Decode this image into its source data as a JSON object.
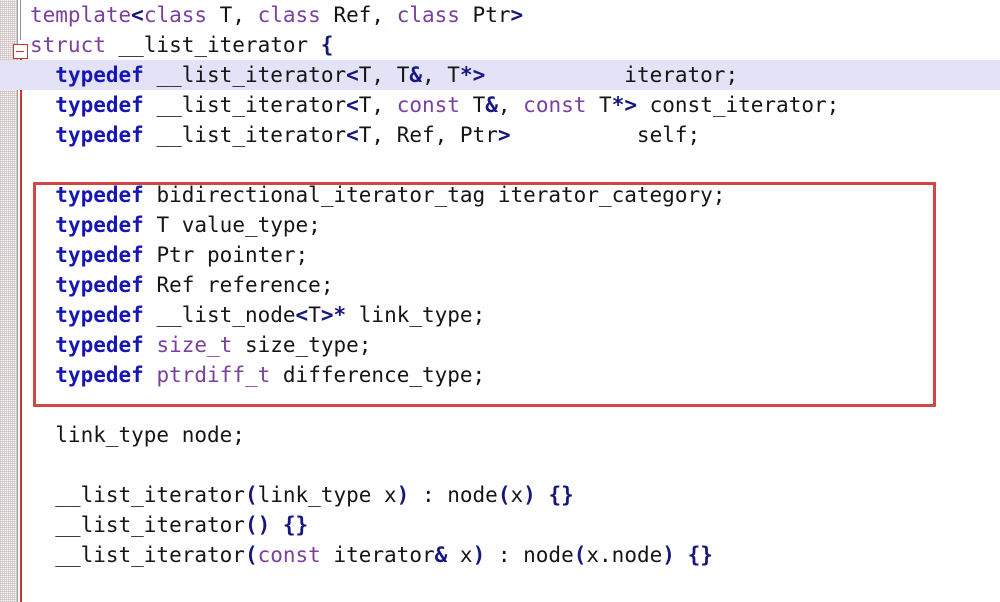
{
  "editor": {
    "title": "code-editor-view",
    "language": "C++",
    "font_size_px": 21,
    "line_height_px": 30,
    "background": "#ffffff",
    "highlight_color": "#e3e2f7",
    "keyword_color": "#7b3fa0",
    "typedef_color": "#1616b4",
    "punctuation_color": "#161680",
    "text_color": "#151515",
    "annotation_color": "#cf4642",
    "fold_marker": {
      "name": "fold-collapse-marker",
      "glyph": "-",
      "line": 2
    }
  },
  "annotation": {
    "name": "red-highlight-box",
    "color": "#cf4642",
    "covers_lines": [
      7,
      8,
      9,
      10,
      11,
      12,
      13
    ]
  },
  "lines": [
    {
      "n": 1,
      "highlighted": false,
      "tokens": [
        {
          "t": "template",
          "c": "kw"
        },
        {
          "t": "<",
          "c": "punct"
        },
        {
          "t": "class",
          "c": "kw"
        },
        {
          "t": " T, ",
          "c": "plain"
        },
        {
          "t": "class",
          "c": "kw"
        },
        {
          "t": " Ref, ",
          "c": "plain"
        },
        {
          "t": "class",
          "c": "kw"
        },
        {
          "t": " Ptr",
          "c": "plain"
        },
        {
          "t": ">",
          "c": "punct"
        }
      ]
    },
    {
      "n": 2,
      "highlighted": false,
      "tokens": [
        {
          "t": "struct",
          "c": "kw"
        },
        {
          "t": " __list_iterator ",
          "c": "plain"
        },
        {
          "t": "{",
          "c": "punct"
        }
      ]
    },
    {
      "n": 3,
      "highlighted": true,
      "tokens": [
        {
          "t": "  ",
          "c": "plain"
        },
        {
          "t": "typedef",
          "c": "tdef"
        },
        {
          "t": " __list_iterator",
          "c": "plain"
        },
        {
          "t": "<",
          "c": "punct"
        },
        {
          "t": "T, T",
          "c": "plain"
        },
        {
          "t": "&",
          "c": "punct"
        },
        {
          "t": ", T",
          "c": "plain"
        },
        {
          "t": "*>",
          "c": "punct"
        },
        {
          "t": "           iterator;",
          "c": "plain"
        }
      ]
    },
    {
      "n": 4,
      "highlighted": false,
      "tokens": [
        {
          "t": "  ",
          "c": "plain"
        },
        {
          "t": "typedef",
          "c": "tdef"
        },
        {
          "t": " __list_iterator",
          "c": "plain"
        },
        {
          "t": "<",
          "c": "punct"
        },
        {
          "t": "T, ",
          "c": "plain"
        },
        {
          "t": "const",
          "c": "kw"
        },
        {
          "t": " T",
          "c": "plain"
        },
        {
          "t": "&",
          "c": "punct"
        },
        {
          "t": ", ",
          "c": "plain"
        },
        {
          "t": "const",
          "c": "kw"
        },
        {
          "t": " T",
          "c": "plain"
        },
        {
          "t": "*>",
          "c": "punct"
        },
        {
          "t": " const_iterator;",
          "c": "plain"
        }
      ]
    },
    {
      "n": 5,
      "highlighted": false,
      "tokens": [
        {
          "t": "  ",
          "c": "plain"
        },
        {
          "t": "typedef",
          "c": "tdef"
        },
        {
          "t": " __list_iterator",
          "c": "plain"
        },
        {
          "t": "<",
          "c": "punct"
        },
        {
          "t": "T, Ref, Ptr",
          "c": "plain"
        },
        {
          "t": ">",
          "c": "punct"
        },
        {
          "t": "          self;",
          "c": "plain"
        }
      ]
    },
    {
      "n": 6,
      "highlighted": false,
      "tokens": [
        {
          "t": "",
          "c": "plain"
        }
      ]
    },
    {
      "n": 7,
      "highlighted": false,
      "tokens": [
        {
          "t": "  ",
          "c": "plain"
        },
        {
          "t": "typedef",
          "c": "tdef"
        },
        {
          "t": " bidirectional_iterator_tag iterator_category;",
          "c": "plain"
        }
      ]
    },
    {
      "n": 8,
      "highlighted": false,
      "tokens": [
        {
          "t": "  ",
          "c": "plain"
        },
        {
          "t": "typedef",
          "c": "tdef"
        },
        {
          "t": " T value_type;",
          "c": "plain"
        }
      ]
    },
    {
      "n": 9,
      "highlighted": false,
      "tokens": [
        {
          "t": "  ",
          "c": "plain"
        },
        {
          "t": "typedef",
          "c": "tdef"
        },
        {
          "t": " Ptr pointer;",
          "c": "plain"
        }
      ]
    },
    {
      "n": 10,
      "highlighted": false,
      "tokens": [
        {
          "t": "  ",
          "c": "plain"
        },
        {
          "t": "typedef",
          "c": "tdef"
        },
        {
          "t": " Ref reference;",
          "c": "plain"
        }
      ]
    },
    {
      "n": 11,
      "highlighted": false,
      "tokens": [
        {
          "t": "  ",
          "c": "plain"
        },
        {
          "t": "typedef",
          "c": "tdef"
        },
        {
          "t": " __list_node",
          "c": "plain"
        },
        {
          "t": "<",
          "c": "punct"
        },
        {
          "t": "T",
          "c": "plain"
        },
        {
          "t": ">*",
          "c": "punct"
        },
        {
          "t": " link_type;",
          "c": "plain"
        }
      ]
    },
    {
      "n": 12,
      "highlighted": false,
      "tokens": [
        {
          "t": "  ",
          "c": "plain"
        },
        {
          "t": "typedef",
          "c": "tdef"
        },
        {
          "t": " ",
          "c": "plain"
        },
        {
          "t": "size_t",
          "c": "kw"
        },
        {
          "t": " size_type;",
          "c": "plain"
        }
      ]
    },
    {
      "n": 13,
      "highlighted": false,
      "tokens": [
        {
          "t": "  ",
          "c": "plain"
        },
        {
          "t": "typedef",
          "c": "tdef"
        },
        {
          "t": " ",
          "c": "plain"
        },
        {
          "t": "ptrdiff_t",
          "c": "kw"
        },
        {
          "t": " difference_type;",
          "c": "plain"
        }
      ]
    },
    {
      "n": 14,
      "highlighted": false,
      "tokens": [
        {
          "t": "",
          "c": "plain"
        }
      ]
    },
    {
      "n": 15,
      "highlighted": false,
      "tokens": [
        {
          "t": "  link_type node;",
          "c": "plain"
        }
      ]
    },
    {
      "n": 16,
      "highlighted": false,
      "tokens": [
        {
          "t": "",
          "c": "plain"
        }
      ]
    },
    {
      "n": 17,
      "highlighted": false,
      "tokens": [
        {
          "t": "  __list_iterator",
          "c": "plain"
        },
        {
          "t": "(",
          "c": "punct"
        },
        {
          "t": "link_type x",
          "c": "plain"
        },
        {
          "t": ")",
          "c": "punct"
        },
        {
          "t": " : node",
          "c": "plain"
        },
        {
          "t": "(",
          "c": "punct"
        },
        {
          "t": "x",
          "c": "plain"
        },
        {
          "t": ")",
          "c": "punct"
        },
        {
          "t": " ",
          "c": "plain"
        },
        {
          "t": "{}",
          "c": "punct"
        }
      ]
    },
    {
      "n": 18,
      "highlighted": false,
      "tokens": [
        {
          "t": "  __list_iterator",
          "c": "plain"
        },
        {
          "t": "()",
          "c": "punct"
        },
        {
          "t": " ",
          "c": "plain"
        },
        {
          "t": "{}",
          "c": "punct"
        }
      ]
    },
    {
      "n": 19,
      "highlighted": false,
      "tokens": [
        {
          "t": "  __list_iterator",
          "c": "plain"
        },
        {
          "t": "(",
          "c": "punct"
        },
        {
          "t": "const",
          "c": "kw"
        },
        {
          "t": " iterator",
          "c": "plain"
        },
        {
          "t": "&",
          "c": "punct"
        },
        {
          "t": " x",
          "c": "plain"
        },
        {
          "t": ")",
          "c": "punct"
        },
        {
          "t": " : node",
          "c": "plain"
        },
        {
          "t": "(",
          "c": "punct"
        },
        {
          "t": "x.node",
          "c": "plain"
        },
        {
          "t": ")",
          "c": "punct"
        },
        {
          "t": " ",
          "c": "plain"
        },
        {
          "t": "{}",
          "c": "punct"
        }
      ]
    },
    {
      "n": 20,
      "highlighted": false,
      "tokens": [
        {
          "t": "",
          "c": "plain"
        }
      ]
    }
  ]
}
